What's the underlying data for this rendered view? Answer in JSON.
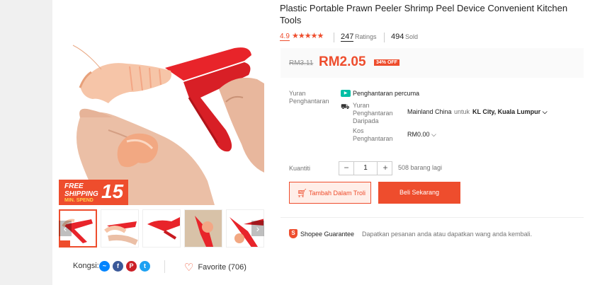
{
  "product": {
    "title": "Plastic Portable Prawn Peeler Shrimp Peel Device Convenient Kitchen Tools"
  },
  "rating": {
    "score": "4.9",
    "stars": "★★★★★",
    "ratings_count": "247",
    "ratings_label": "Ratings",
    "sold_count": "494",
    "sold_label": "Sold"
  },
  "price": {
    "original": "RM3.11",
    "current": "RM2.05",
    "discount": "34% OFF"
  },
  "promo_badge": {
    "line1": "FREE",
    "line2": "SHIPPING",
    "line3": "MIN. SPEND",
    "amount": "15"
  },
  "shipping": {
    "label": "Yuran Penghantaran",
    "free_text": "Penghantaran percuma",
    "from_label": "Yuran Penghantaran Daripada",
    "from_location": "Mainland China",
    "to_word": "untuk",
    "to_location": "KL City, Kuala Lumpur",
    "cost_label": "Kos Penghantaran",
    "cost_value": "RM0.00"
  },
  "quantity": {
    "label": "Kuantiti",
    "minus": "−",
    "value": "1",
    "plus": "+",
    "stock": "508 barang lagi"
  },
  "actions": {
    "add_to_cart": "Tambah Dalam Troli",
    "buy_now": "Beli Sekarang"
  },
  "guarantee": {
    "title": "Shopee Guarantee",
    "text": "Dapatkan pesanan anda atau dapatkan wang anda kembali."
  },
  "share": {
    "label": "Kongsi:",
    "networks": [
      "messenger-icon",
      "facebook-icon",
      "pinterest-icon",
      "twitter-icon"
    ]
  },
  "favorite": {
    "label": "Favorite (706)"
  },
  "colors": {
    "brand": "#ee4d2d",
    "free_shipping": "#00bfa5"
  }
}
